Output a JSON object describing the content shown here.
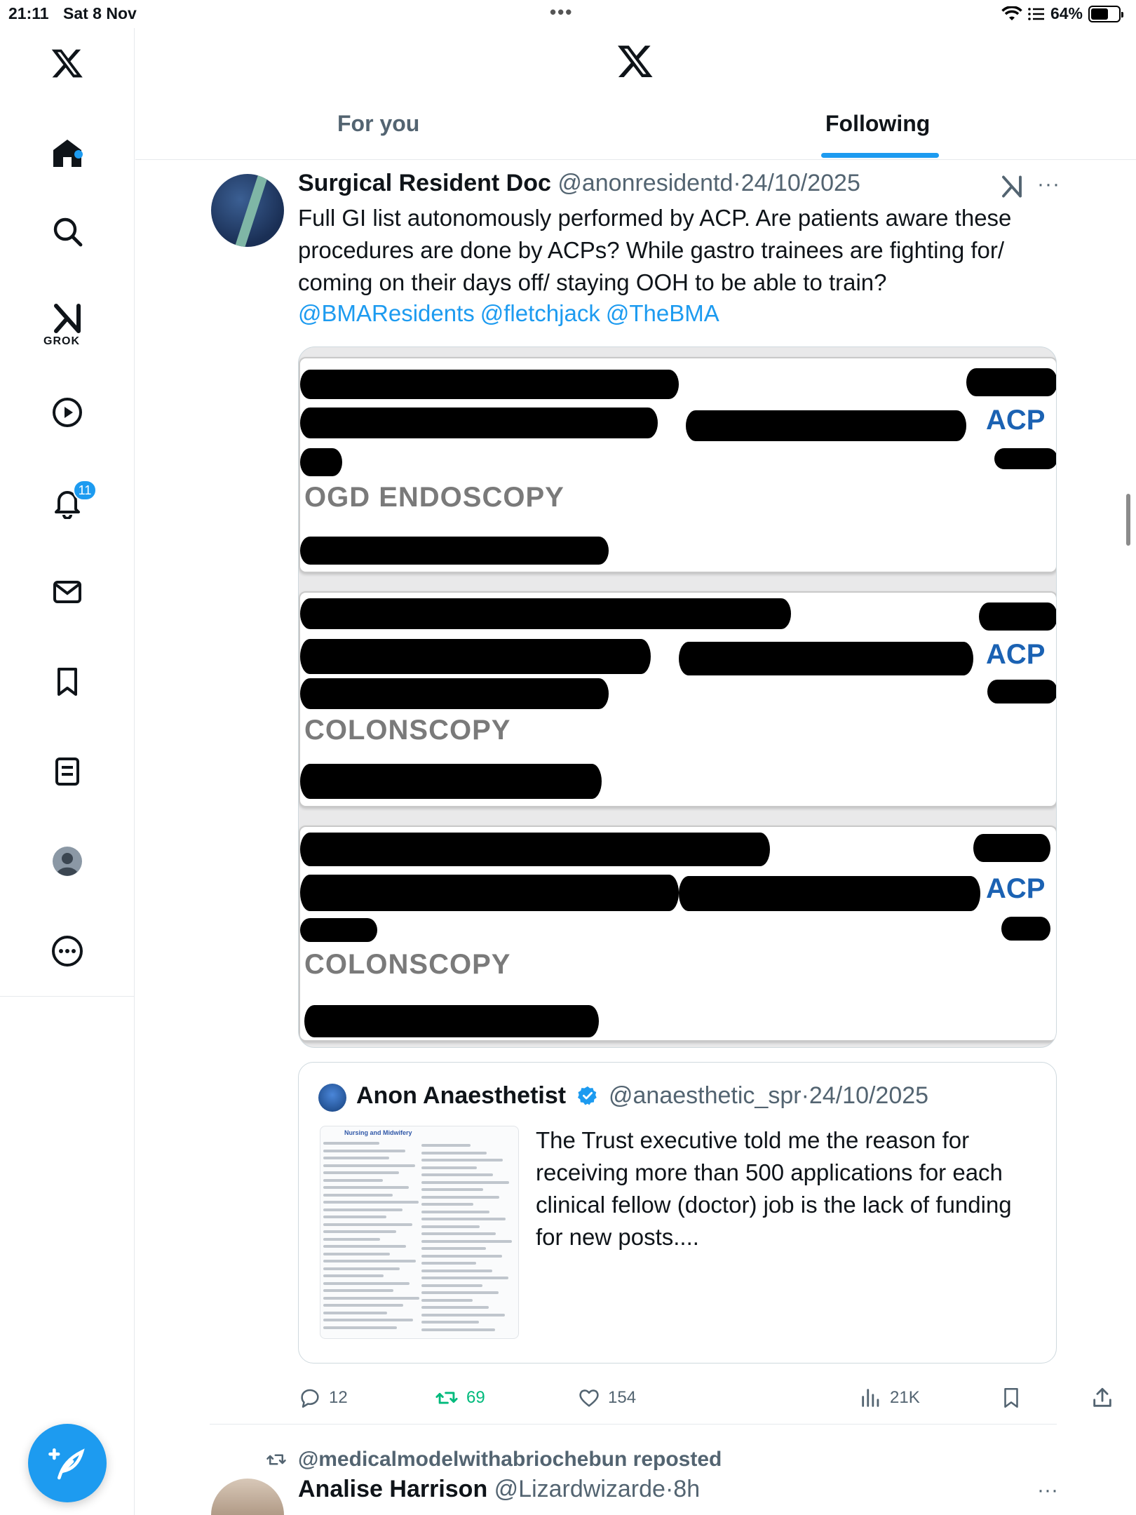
{
  "status_bar": {
    "time": "21:11",
    "date": "Sat 8 Nov",
    "battery": "64%",
    "battery_level": 0.64
  },
  "sidebar": {
    "items": [
      {
        "name": "x-logo-icon"
      },
      {
        "name": "home-icon"
      },
      {
        "name": "search-icon"
      },
      {
        "name": "grok-icon",
        "label": "GROK"
      },
      {
        "name": "video-icon"
      },
      {
        "name": "notifications-icon",
        "badge": "11"
      },
      {
        "name": "messages-icon"
      },
      {
        "name": "bookmarks-icon"
      },
      {
        "name": "lists-icon"
      },
      {
        "name": "profile-icon"
      },
      {
        "name": "more-icon"
      }
    ]
  },
  "header": {
    "tabs": [
      {
        "label": "For you",
        "active": false
      },
      {
        "label": "Following",
        "active": true
      }
    ]
  },
  "tweet": {
    "name": "Surgical Resident Doc",
    "handle": "@anonresidentd",
    "separator": "·",
    "date": "24/10/2025",
    "text": "Full GI list autonomously performed by ACP. Are patients aware these procedures are done by ACPs? While gastro trainees are fighting for/ coming on their days off/ staying OOH to be able to train?",
    "mentions": [
      "@BMAResidents",
      "@fletchjack",
      "@TheBMA"
    ],
    "media_cards": [
      {
        "procedure": "OGD ENDOSCOPY",
        "role": "ACP"
      },
      {
        "procedure": "COLONSCOPY",
        "role": "ACP"
      },
      {
        "procedure": "COLONSCOPY",
        "role": "ACP"
      }
    ],
    "quote": {
      "name": "Anon Anaesthetist",
      "handle": "@anaesthetic_spr",
      "separator": "·",
      "date": "24/10/2025",
      "thumb_title": "Nursing and Midwifery",
      "text": "The Trust executive told me the reason for receiving more than 500 applications for each clinical fellow (doctor) job is the lack of funding for new posts...."
    },
    "actions": {
      "replies": "12",
      "reposts": "69",
      "likes": "154",
      "views": "21K"
    }
  },
  "next_tweet": {
    "repost_by": "@medicalmodelwithabriochebun reposted",
    "name": "Analise Harrison",
    "handle": "@Lizardwizarde",
    "separator": "·",
    "time": "8h"
  },
  "colors": {
    "accent": "#1d9bf0",
    "repost_green": "#00ba7c",
    "secondary_text": "#536471",
    "acp_blue": "#1b62b3"
  }
}
